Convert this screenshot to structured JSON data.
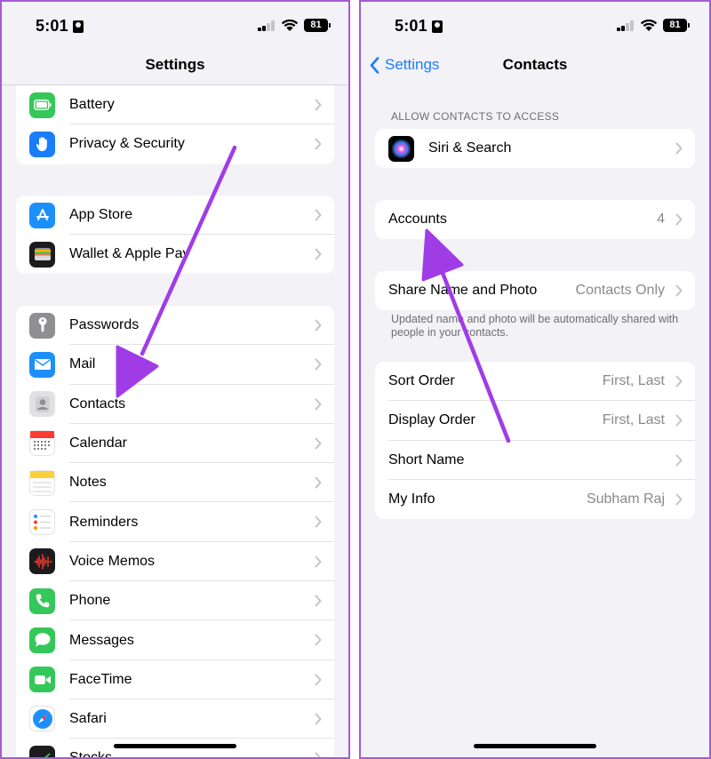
{
  "status": {
    "time": "5:01",
    "battery": "81"
  },
  "left": {
    "title": "Settings",
    "groups": [
      [
        {
          "label": "Battery",
          "icon": "battery-icon"
        },
        {
          "label": "Privacy & Security",
          "icon": "hand-icon"
        }
      ],
      [
        {
          "label": "App Store",
          "icon": "app-store-icon"
        },
        {
          "label": "Wallet & Apple Pay",
          "icon": "wallet-icon"
        }
      ],
      [
        {
          "label": "Passwords",
          "icon": "key-icon"
        },
        {
          "label": "Mail",
          "icon": "mail-icon"
        },
        {
          "label": "Contacts",
          "icon": "contacts-icon"
        },
        {
          "label": "Calendar",
          "icon": "calendar-icon"
        },
        {
          "label": "Notes",
          "icon": "notes-icon"
        },
        {
          "label": "Reminders",
          "icon": "reminders-icon"
        },
        {
          "label": "Voice Memos",
          "icon": "voice-memos-icon"
        },
        {
          "label": "Phone",
          "icon": "phone-icon"
        },
        {
          "label": "Messages",
          "icon": "messages-icon"
        },
        {
          "label": "FaceTime",
          "icon": "facetime-icon"
        },
        {
          "label": "Safari",
          "icon": "safari-icon"
        },
        {
          "label": "Stocks",
          "icon": "stocks-icon"
        }
      ]
    ]
  },
  "right": {
    "back": "Settings",
    "title": "Contacts",
    "section_header": "ALLOW CONTACTS TO ACCESS",
    "siri": {
      "label": "Siri & Search"
    },
    "accounts": {
      "label": "Accounts",
      "value": "4"
    },
    "share": {
      "label": "Share Name and Photo",
      "value": "Contacts Only"
    },
    "footnote": "Updated name and photo will be automatically shared with people in your contacts.",
    "options": [
      {
        "label": "Sort Order",
        "value": "First, Last"
      },
      {
        "label": "Display Order",
        "value": "First, Last"
      },
      {
        "label": "Short Name",
        "value": ""
      },
      {
        "label": "My Info",
        "value": "Subham Raj"
      }
    ]
  },
  "colors": {
    "accent": "#1a7dfa",
    "annotation": "#a03ce6",
    "border": "#a55bd6"
  }
}
